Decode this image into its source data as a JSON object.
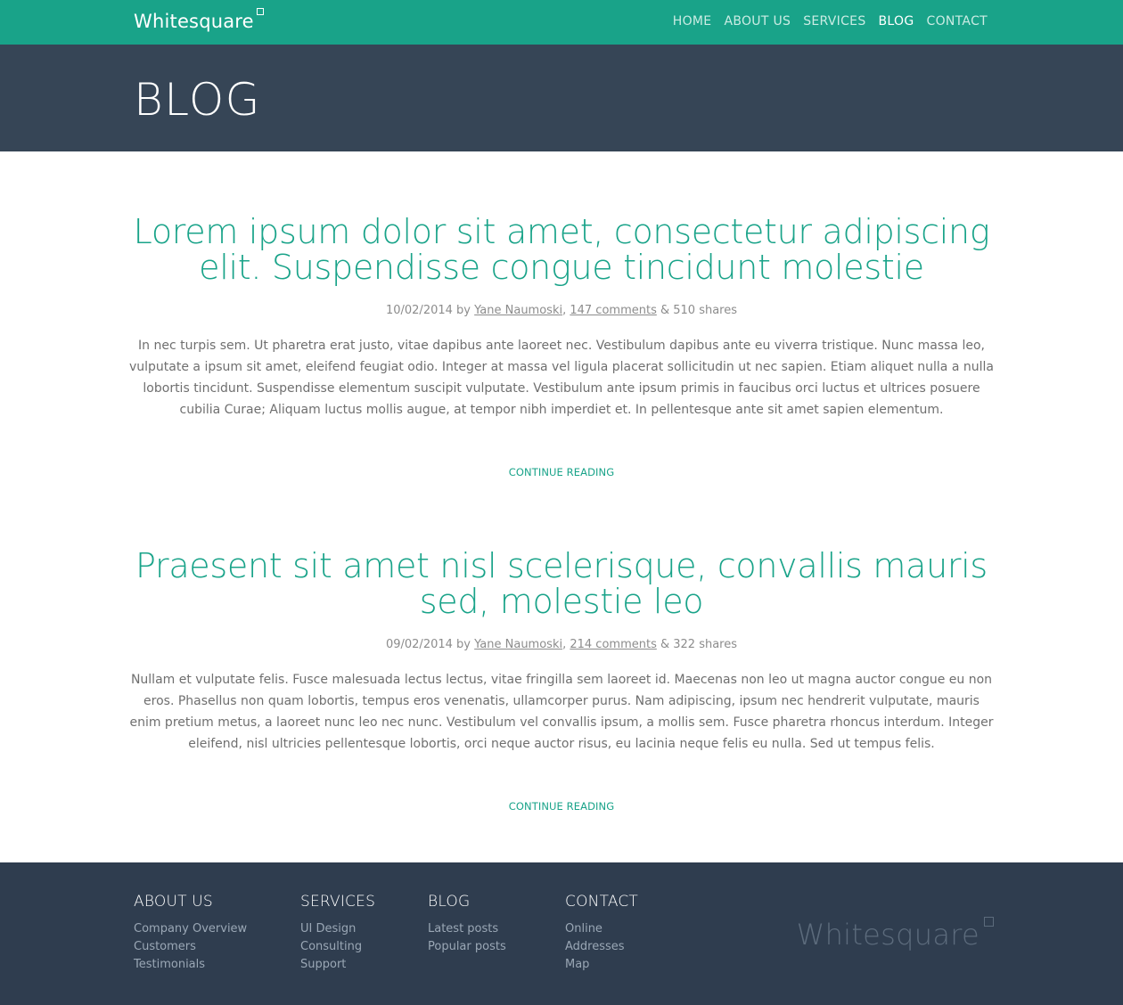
{
  "header": {
    "brand": "Whitesquare",
    "nav": [
      "HOME",
      "ABOUT US",
      "SERVICES",
      "BLOG",
      "CONTACT"
    ],
    "active_nav": "BLOG"
  },
  "page": {
    "title": "BLOG"
  },
  "posts": [
    {
      "title": "Lorem ipsum dolor sit amet, consectetur adipiscing elit. Suspendisse congue tincidunt molestie",
      "date": "10/02/2014",
      "by": "by",
      "author": "Yane Naumoski",
      "comments": "147 comments",
      "shares": "& 510 shares",
      "body": "In nec turpis sem. Ut pharetra erat justo, vitae dapibus ante laoreet nec. Vestibulum dapibus ante eu viverra tristique. Nunc massa leo, vulputate a ipsum sit amet, eleifend feugiat odio. Integer at massa vel ligula placerat sollicitudin ut nec sapien. Etiam aliquet nulla a nulla lobortis tincidunt. Suspendisse elementum suscipit vulputate. Vestibulum ante ipsum primis in faucibus orci luctus et ultrices posuere cubilia Curae; Aliquam luctus mollis augue, at tempor nibh imperdiet et. In pellentesque ante sit amet sapien elementum.",
      "read_more": "CONTINUE READING"
    },
    {
      "title": "Praesent sit amet nisl scelerisque, convallis mauris sed, molestie leo",
      "date": "09/02/2014",
      "by": "by",
      "author": "Yane Naumoski",
      "comments": "214 comments",
      "shares": "& 322 shares",
      "body": "Nullam et vulputate felis. Fusce malesuada lectus lectus, vitae fringilla sem laoreet id. Maecenas non leo ut magna auctor congue eu non eros. Phasellus non quam lobortis, tempus eros venenatis, ullamcorper purus. Nam adipiscing, ipsum nec hendrerit vulputate, mauris enim pretium metus, a laoreet nunc leo nec nunc. Vestibulum vel convallis ipsum, a mollis sem. Fusce pharetra rhoncus interdum. Integer eleifend, nisl ultricies pellentesque lobortis, orci neque auctor risus, eu lacinia neque felis eu nulla. Sed ut tempus felis.",
      "read_more": "CONTINUE READING"
    }
  ],
  "footer": {
    "columns": [
      {
        "title": "ABOUT US",
        "links": [
          "Company Overview",
          "Customers",
          "Testimonials"
        ]
      },
      {
        "title": "SERVICES",
        "links": [
          "UI Design",
          "Consulting",
          "Support"
        ]
      },
      {
        "title": "BLOG",
        "links": [
          "Latest posts",
          "Popular posts"
        ]
      },
      {
        "title": "CONTACT",
        "links": [
          "Online",
          "Addresses",
          "Map"
        ]
      }
    ],
    "brand": "Whitesquare"
  },
  "colors": {
    "accent": "#19a389",
    "page_header_bg": "#364556",
    "footer_bg": "#2f3d4f"
  }
}
